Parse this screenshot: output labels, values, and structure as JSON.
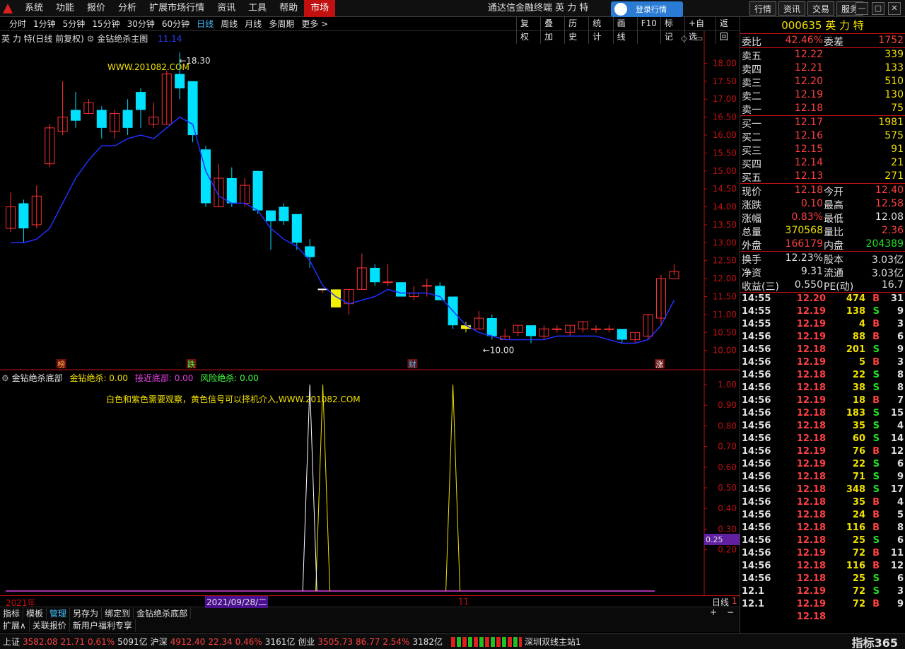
{
  "menubar": {
    "menus": [
      "系统",
      "功能",
      "报价",
      "分析",
      "扩展市场行情",
      "资讯",
      "工具",
      "帮助",
      "市场"
    ],
    "title": "通达信金融终端  英 力 特",
    "login": "登录行情",
    "right_buttons": [
      "行情",
      "资讯",
      "交易",
      "服务"
    ],
    "window_controls": [
      "—",
      "▢",
      "✕"
    ]
  },
  "periodbar": {
    "periods": [
      "分时",
      "1分钟",
      "5分钟",
      "15分钟",
      "30分钟",
      "60分钟",
      "日线",
      "周线",
      "月线",
      "多周期",
      "更多 >"
    ],
    "selected": "日线",
    "tools": [
      "复权",
      "叠加",
      "历史",
      "统计",
      "画线",
      "F10",
      "标记",
      "+自选",
      "返回"
    ]
  },
  "main_chart": {
    "title": "英 力 特(日线 前复权)",
    "indicator": "金钻绝杀主图",
    "ma_value": "11.14",
    "watermark": "WWW.201082.COM",
    "high_label": "18.30",
    "low_label": "10.00",
    "markers": [
      {
        "text": "榜",
        "idx": 4,
        "color": "#ffb040"
      },
      {
        "text": "跌",
        "idx": 14,
        "color": "#40ff40"
      },
      {
        "text": "财",
        "idx": 31,
        "color": "#40c0ff"
      },
      {
        "text": "涨",
        "idx": 50,
        "color": "#ffffff"
      }
    ]
  },
  "sub_chart": {
    "title": "金钻绝杀底部",
    "legend": [
      {
        "label": "金钻绝杀:",
        "value": "0.00",
        "color": "#f0e000"
      },
      {
        "label": "接近底部:",
        "value": "0.00",
        "color": "#e040e0"
      },
      {
        "label": "风险绝杀:",
        "value": "0.00",
        "color": "#40ff40"
      }
    ],
    "note": "白色和紫色需要观察，黄色信号可以择机介入,WWW.201082.COM",
    "current_value": "0.25"
  },
  "chart_data": [
    {
      "type": "candlestick",
      "title": "英 力 特(日线 前复权)",
      "ylim": [
        9.6,
        18.6
      ],
      "y_ticks": [
        10.0,
        10.5,
        11.0,
        11.5,
        12.0,
        12.5,
        13.0,
        13.5,
        14.0,
        14.5,
        15.0,
        15.5,
        16.0,
        16.5,
        17.0,
        17.5,
        18.0
      ],
      "candles": [
        [
          13.4,
          14.0,
          13.3,
          14.4
        ],
        [
          14.1,
          13.4,
          13.0,
          14.2
        ],
        [
          13.5,
          14.3,
          13.4,
          14.6
        ],
        [
          15.2,
          16.2,
          15.1,
          16.3
        ],
        [
          16.1,
          16.5,
          16.0,
          17.5
        ],
        [
          16.7,
          16.4,
          16.2,
          17.2
        ],
        [
          16.6,
          16.9,
          16.6,
          17.0
        ],
        [
          16.7,
          16.2,
          15.9,
          16.8
        ],
        [
          16.1,
          16.6,
          15.9,
          16.7
        ],
        [
          16.7,
          16.2,
          16.0,
          17.0
        ],
        [
          17.2,
          16.7,
          16.2,
          17.3
        ],
        [
          16.3,
          16.5,
          16.2,
          16.9
        ],
        [
          16.3,
          17.7,
          16.3,
          17.8
        ],
        [
          17.7,
          17.3,
          17.0,
          18.3
        ],
        [
          17.5,
          16.0,
          15.8,
          17.5
        ],
        [
          15.6,
          14.1,
          14.0,
          15.7
        ],
        [
          14.0,
          14.8,
          14.0,
          15.2
        ],
        [
          14.8,
          14.1,
          14.0,
          15.1
        ],
        [
          14.1,
          14.6,
          14.0,
          14.8
        ],
        [
          15.0,
          13.9,
          13.8,
          15.0
        ],
        [
          13.9,
          13.6,
          12.8,
          13.9
        ],
        [
          14.0,
          13.6,
          13.5,
          14.1
        ],
        [
          13.8,
          13.0,
          12.8,
          13.8
        ],
        [
          12.9,
          12.6,
          12.3,
          13.1
        ],
        [
          11.7,
          11.7,
          11.6,
          11.7
        ],
        [
          11.7,
          11.2,
          11.2,
          11.7
        ],
        [
          11.3,
          11.7,
          11.0,
          11.7
        ],
        [
          11.7,
          12.3,
          11.7,
          12.7
        ],
        [
          12.3,
          11.9,
          11.8,
          12.4
        ],
        [
          11.9,
          11.9,
          11.8,
          12.4
        ],
        [
          11.9,
          11.5,
          11.5,
          11.9
        ],
        [
          11.5,
          11.6,
          11.4,
          11.8
        ],
        [
          11.8,
          11.8,
          11.5,
          12.0
        ],
        [
          11.8,
          11.4,
          11.4,
          11.9
        ],
        [
          11.5,
          10.7,
          10.6,
          11.5
        ],
        [
          10.7,
          10.6,
          10.5,
          10.8
        ],
        [
          10.6,
          10.9,
          10.6,
          11.1
        ],
        [
          10.9,
          10.4,
          10.3,
          11.0
        ],
        [
          10.3,
          10.4,
          10.3,
          10.6
        ],
        [
          10.5,
          10.7,
          10.4,
          10.7
        ],
        [
          10.7,
          10.4,
          10.2,
          10.7
        ],
        [
          10.4,
          10.6,
          10.3,
          10.7
        ],
        [
          10.6,
          10.6,
          10.5,
          10.7
        ],
        [
          10.5,
          10.7,
          10.4,
          10.7
        ],
        [
          10.6,
          10.8,
          10.5,
          10.8
        ],
        [
          10.6,
          10.6,
          10.5,
          10.7
        ],
        [
          10.6,
          10.6,
          10.5,
          10.7
        ],
        [
          10.6,
          10.3,
          10.2,
          10.6
        ],
        [
          10.3,
          10.5,
          10.2,
          10.5
        ],
        [
          10.4,
          11.0,
          10.3,
          11.0
        ],
        [
          10.9,
          12.0,
          10.7,
          12.1
        ],
        [
          12.0,
          12.2,
          12.1,
          12.4
        ]
      ],
      "doji_indices": [
        24,
        29,
        32
      ],
      "highlight_indices": [
        25,
        35
      ],
      "ma": [
        13.0,
        13.0,
        13.1,
        13.4,
        14.1,
        14.8,
        15.3,
        15.7,
        15.7,
        15.9,
        16.0,
        15.9,
        16.2,
        16.5,
        16.3,
        15.0,
        14.3,
        14.1,
        14.1,
        13.9,
        13.4,
        13.1,
        12.9,
        12.5,
        11.8,
        11.5,
        11.3,
        11.4,
        11.5,
        11.7,
        11.6,
        11.6,
        11.6,
        11.5,
        11.1,
        10.7,
        10.5,
        10.4,
        10.3,
        10.3,
        10.3,
        10.3,
        10.4,
        10.4,
        10.4,
        10.4,
        10.3,
        10.2,
        10.2,
        10.3,
        10.7,
        11.4
      ]
    },
    {
      "type": "line",
      "title": "金钻绝杀底部",
      "ylim": [
        0,
        1.0
      ],
      "y_ticks": [
        0.2,
        0.3,
        0.4,
        0.5,
        0.6,
        0.7,
        0.8,
        0.9,
        1.0
      ],
      "series": [
        {
          "name": "金钻绝杀",
          "color": "#f0e000",
          "spikes": [
            24,
            34
          ]
        },
        {
          "name": "白色信号",
          "color": "#ffffff",
          "spikes": [
            23
          ]
        }
      ],
      "baseline_color": "#e040e0"
    }
  ],
  "axis": {
    "year_label": "2021年",
    "date_label": "2021/09/28/二",
    "month_label": "11",
    "period_label": "日线",
    "period_suffix": "1"
  },
  "tabs_row1": [
    "指标",
    "模板",
    "管理",
    "另存为",
    "绑定到",
    "金钻绝杀底部"
  ],
  "tabs_row1_selected": "管理",
  "tabs_row2": [
    "扩展∧",
    "关联报价",
    "新用户福利专享"
  ],
  "statusbar": {
    "items": [
      {
        "name": "上证",
        "price": "3582.08",
        "chg": "21.71",
        "pct": "0.61%",
        "vol": "5091亿"
      },
      {
        "name": "沪深",
        "price": "4912.40",
        "chg": "22.34",
        "pct": "0.46%",
        "vol": "3161亿"
      },
      {
        "name": "创业",
        "price": "3505.73",
        "chg": "86.77",
        "pct": "2.54%",
        "vol": "3182亿"
      }
    ],
    "server": "深圳双线主站1",
    "brand": "指标365"
  },
  "quote": {
    "code": "000635 英 力 特",
    "weibi": {
      "label": "委比",
      "value": "42.46%",
      "label2": "委差",
      "value2": "1752"
    },
    "asks": [
      {
        "label": "卖五",
        "price": "12.22",
        "vol": "339"
      },
      {
        "label": "卖四",
        "price": "12.21",
        "vol": "133"
      },
      {
        "label": "卖三",
        "price": "12.20",
        "vol": "510"
      },
      {
        "label": "卖二",
        "price": "12.19",
        "vol": "130"
      },
      {
        "label": "卖一",
        "price": "12.18",
        "vol": "75"
      }
    ],
    "bids": [
      {
        "label": "买一",
        "price": "12.17",
        "vol": "1981"
      },
      {
        "label": "买二",
        "price": "12.16",
        "vol": "575"
      },
      {
        "label": "买三",
        "price": "12.15",
        "vol": "91"
      },
      {
        "label": "买四",
        "price": "12.14",
        "vol": "21"
      },
      {
        "label": "买五",
        "price": "12.13",
        "vol": "271"
      }
    ],
    "stats1": [
      {
        "l1": "现价",
        "v1": "12.18",
        "c1": "r",
        "l2": "今开",
        "v2": "12.40",
        "c2": "r"
      },
      {
        "l1": "涨跌",
        "v1": "0.10",
        "c1": "r",
        "l2": "最高",
        "v2": "12.58",
        "c2": "r"
      },
      {
        "l1": "涨幅",
        "v1": "0.83%",
        "c1": "r",
        "l2": "最低",
        "v2": "12.08",
        "c2": "w"
      },
      {
        "l1": "总量",
        "v1": "370568",
        "c1": "y",
        "l2": "量比",
        "v2": "2.36",
        "c2": "r"
      },
      {
        "l1": "外盘",
        "v1": "166179",
        "c1": "r",
        "l2": "内盘",
        "v2": "204389",
        "c2": "g"
      }
    ],
    "stats2": [
      {
        "l1": "换手",
        "v1": "12.23%",
        "c1": "w",
        "l2": "股本",
        "v2": "3.03亿",
        "c2": "w"
      },
      {
        "l1": "净资",
        "v1": "9.31",
        "c1": "w",
        "l2": "流通",
        "v2": "3.03亿",
        "c2": "w"
      },
      {
        "l1": "收益(三)",
        "v1": "0.550",
        "c1": "w",
        "l2": "PE(动)",
        "v2": "16.7",
        "c2": "w"
      }
    ],
    "ticks": [
      {
        "t": "14:55",
        "p": "12.20",
        "v": "474",
        "bs": "B",
        "n": "31"
      },
      {
        "t": "14:55",
        "p": "12.19",
        "v": "138",
        "bs": "S",
        "n": "9"
      },
      {
        "t": "14:55",
        "p": "12.19",
        "v": "4",
        "bs": "B",
        "n": "3"
      },
      {
        "t": "14:56",
        "p": "12.19",
        "v": "88",
        "bs": "B",
        "n": "6"
      },
      {
        "t": "14:56",
        "p": "12.18",
        "v": "201",
        "bs": "S",
        "n": "9"
      },
      {
        "t": "14:56",
        "p": "12.19",
        "v": "5",
        "bs": "B",
        "n": "3"
      },
      {
        "t": "14:56",
        "p": "12.18",
        "v": "22",
        "bs": "S",
        "n": "8"
      },
      {
        "t": "14:56",
        "p": "12.18",
        "v": "38",
        "bs": "S",
        "n": "8"
      },
      {
        "t": "14:56",
        "p": "12.19",
        "v": "18",
        "bs": "B",
        "n": "7"
      },
      {
        "t": "14:56",
        "p": "12.18",
        "v": "183",
        "bs": "S",
        "n": "15"
      },
      {
        "t": "14:56",
        "p": "12.18",
        "v": "35",
        "bs": "S",
        "n": "4"
      },
      {
        "t": "14:56",
        "p": "12.18",
        "v": "60",
        "bs": "S",
        "n": "14"
      },
      {
        "t": "14:56",
        "p": "12.19",
        "v": "76",
        "bs": "B",
        "n": "12"
      },
      {
        "t": "14:56",
        "p": "12.19",
        "v": "22",
        "bs": "S",
        "n": "6"
      },
      {
        "t": "14:56",
        "p": "12.18",
        "v": "71",
        "bs": "S",
        "n": "9"
      },
      {
        "t": "14:56",
        "p": "12.18",
        "v": "348",
        "bs": "S",
        "n": "17"
      },
      {
        "t": "14:56",
        "p": "12.18",
        "v": "35",
        "bs": "B",
        "n": "4"
      },
      {
        "t": "14:56",
        "p": "12.18",
        "v": "24",
        "bs": "B",
        "n": "5"
      },
      {
        "t": "14:56",
        "p": "12.18",
        "v": "116",
        "bs": "B",
        "n": "8"
      },
      {
        "t": "14:56",
        "p": "12.18",
        "v": "25",
        "bs": "S",
        "n": "6"
      },
      {
        "t": "14:56",
        "p": "12.19",
        "v": "72",
        "bs": "B",
        "n": "11"
      },
      {
        "t": "14:56",
        "p": "12.18",
        "v": "116",
        "bs": "B",
        "n": "12"
      },
      {
        "t": "14:56",
        "p": "12.18",
        "v": "25",
        "bs": "S",
        "n": "6"
      },
      {
        "t": "12.1",
        "p": "12.19",
        "v": "72",
        "bs": "S",
        "n": "3"
      },
      {
        "t": "12.1",
        "p": "12.19",
        "v": "72",
        "bs": "B",
        "n": "9"
      },
      {
        "t": "",
        "p": "12.18",
        "v": "",
        "bs": "",
        "n": ""
      }
    ]
  }
}
